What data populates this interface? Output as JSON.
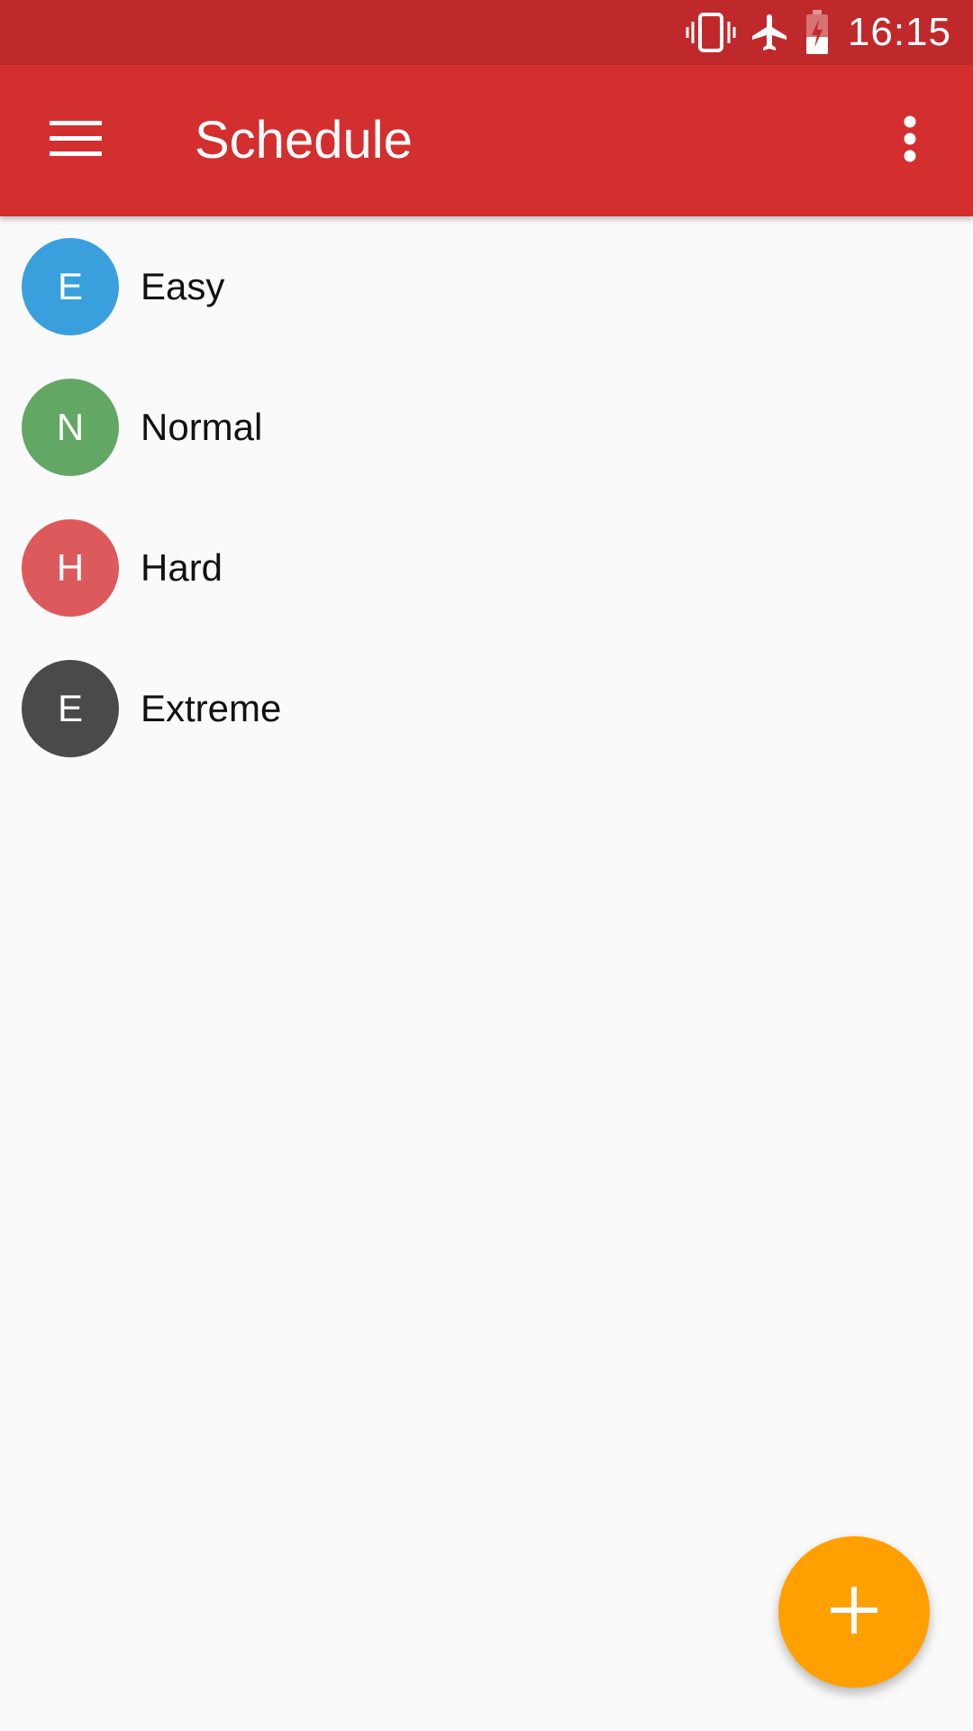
{
  "status_bar": {
    "time": "16:15",
    "icons": [
      "vibrate-icon",
      "airplane-mode-icon",
      "battery-charging-icon"
    ]
  },
  "app_bar": {
    "title": "Schedule",
    "menu_icon": "hamburger-menu-icon",
    "overflow_icon": "more-vert-icon"
  },
  "list": {
    "items": [
      {
        "initial": "E",
        "label": "Easy",
        "color": "#3a9fdd"
      },
      {
        "initial": "N",
        "label": "Normal",
        "color": "#63a765"
      },
      {
        "initial": "H",
        "label": "Hard",
        "color": "#dd5a5c"
      },
      {
        "initial": "E",
        "label": "Extreme",
        "color": "#4a4a4a"
      }
    ]
  },
  "fab": {
    "icon": "add-icon",
    "color": "#ffa000"
  },
  "colors": {
    "status_bar": "#c0292b",
    "app_bar": "#d32f2f",
    "background": "#fafafa"
  }
}
